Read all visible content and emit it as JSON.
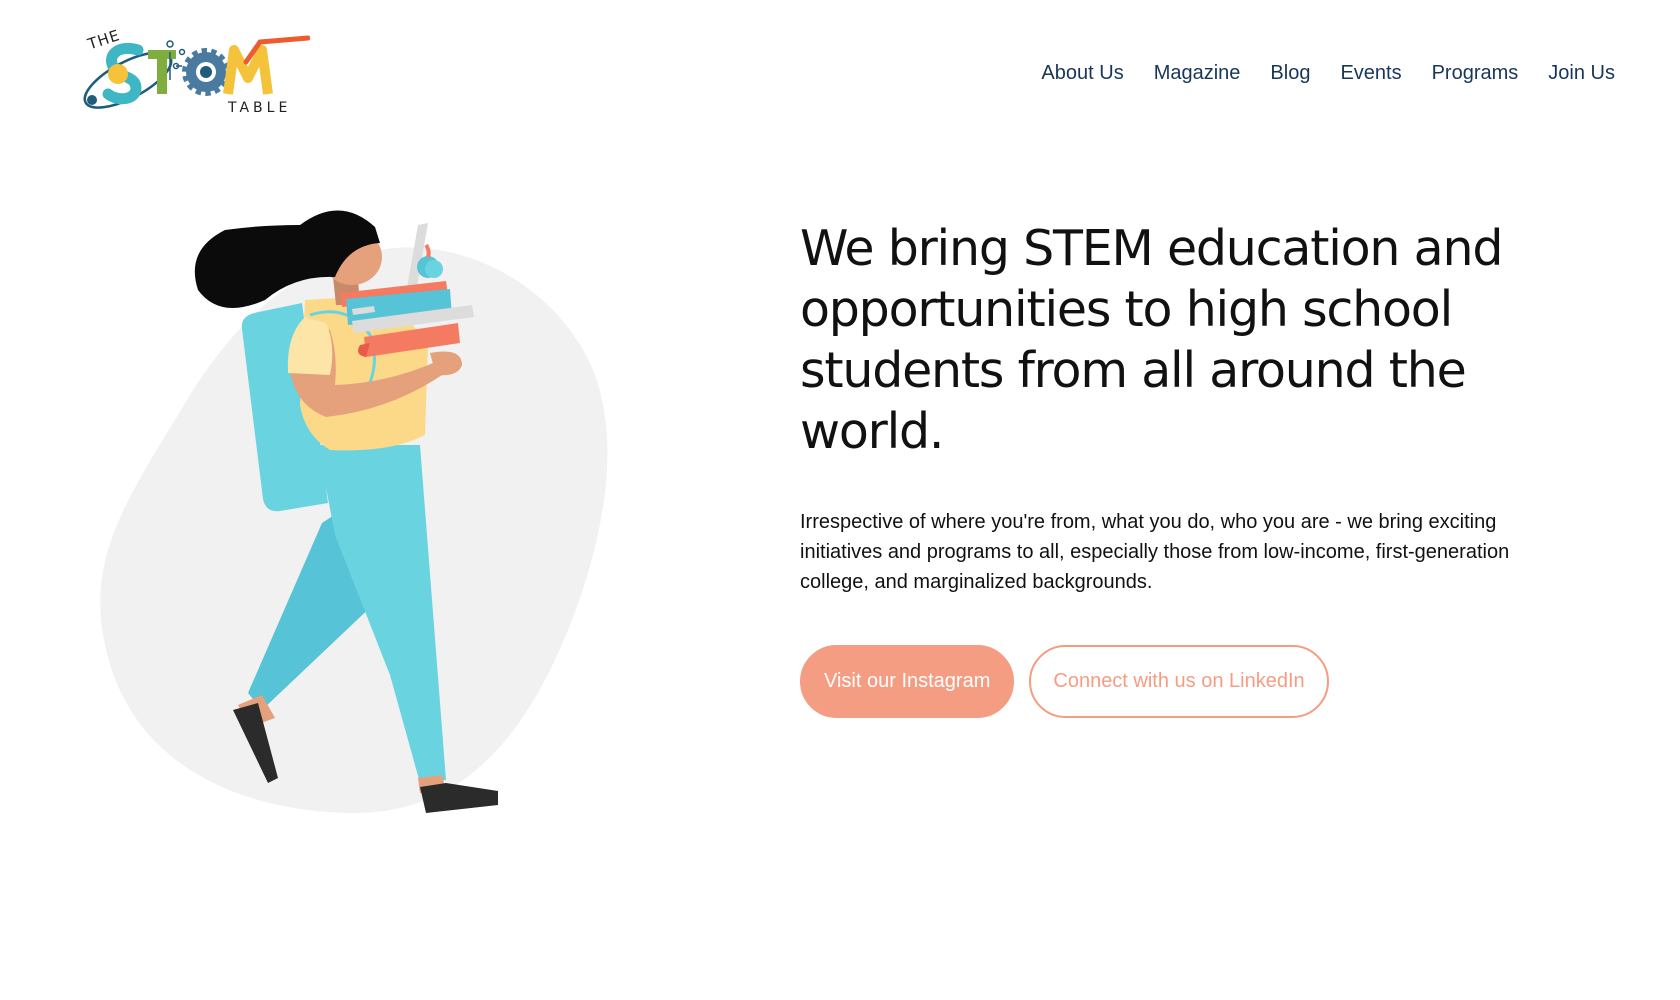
{
  "brand": {
    "logo_top_word": "THE",
    "logo_bottom_word": "TABLE",
    "colors": {
      "teal": "#3fb6c4",
      "yellow": "#f5c33b",
      "green": "#7fae3e",
      "navy": "#1f5c7a",
      "orange": "#ee5b2f",
      "gear": "#4a7aa0"
    }
  },
  "nav": {
    "items": [
      {
        "label": "About Us"
      },
      {
        "label": "Magazine"
      },
      {
        "label": "Blog"
      },
      {
        "label": "Events"
      },
      {
        "label": "Programs"
      },
      {
        "label": "Join Us"
      }
    ],
    "color": "#17365a"
  },
  "hero": {
    "title": "We bring STEM education and opportunities to high school students from all around the world.",
    "description": "Irrespective of where you're from, what you do, who you are - we bring exciting initiatives and programs to all, especially those from low-income, first-generation college, and marginalized backgrounds.",
    "primary_button": "Visit our Instagram",
    "secondary_button": "Connect with us on LinkedIn",
    "accent_color": "#f59d82"
  },
  "illustration": {
    "icon": "student-carrying-books-illustration"
  }
}
